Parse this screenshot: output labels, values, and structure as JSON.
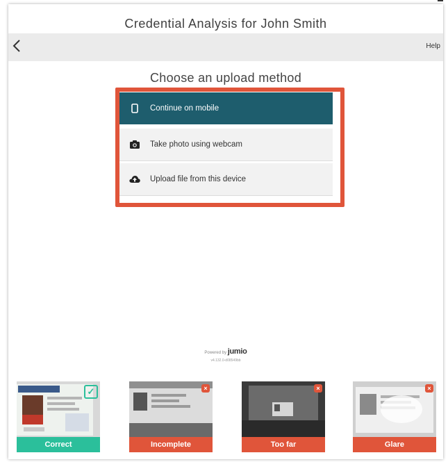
{
  "window": {
    "title": "Credential Analysis for John Smith"
  },
  "nav": {
    "back_icon": "chevron-left-icon",
    "help_label": "Help"
  },
  "main": {
    "heading": "Choose an upload method",
    "options": [
      {
        "label": "Continue on mobile",
        "icon": "phone-icon"
      },
      {
        "label": "Take photo using webcam",
        "icon": "camera-icon"
      },
      {
        "label": "Upload file from this device",
        "icon": "cloud-upload-icon"
      }
    ]
  },
  "footer": {
    "powered_prefix": "Powered by",
    "brand": "jumio",
    "version": "v4.132.0-d08549bb"
  },
  "examples": [
    {
      "label": "Correct",
      "status": "good"
    },
    {
      "label": "Incomplete",
      "status": "bad"
    },
    {
      "label": "Too far",
      "status": "bad"
    },
    {
      "label": "Glare",
      "status": "bad"
    }
  ],
  "colors": {
    "primary": "#1e5d6d",
    "highlight": "#e0553a",
    "good": "#2bbf9b",
    "bad": "#e0553a"
  }
}
